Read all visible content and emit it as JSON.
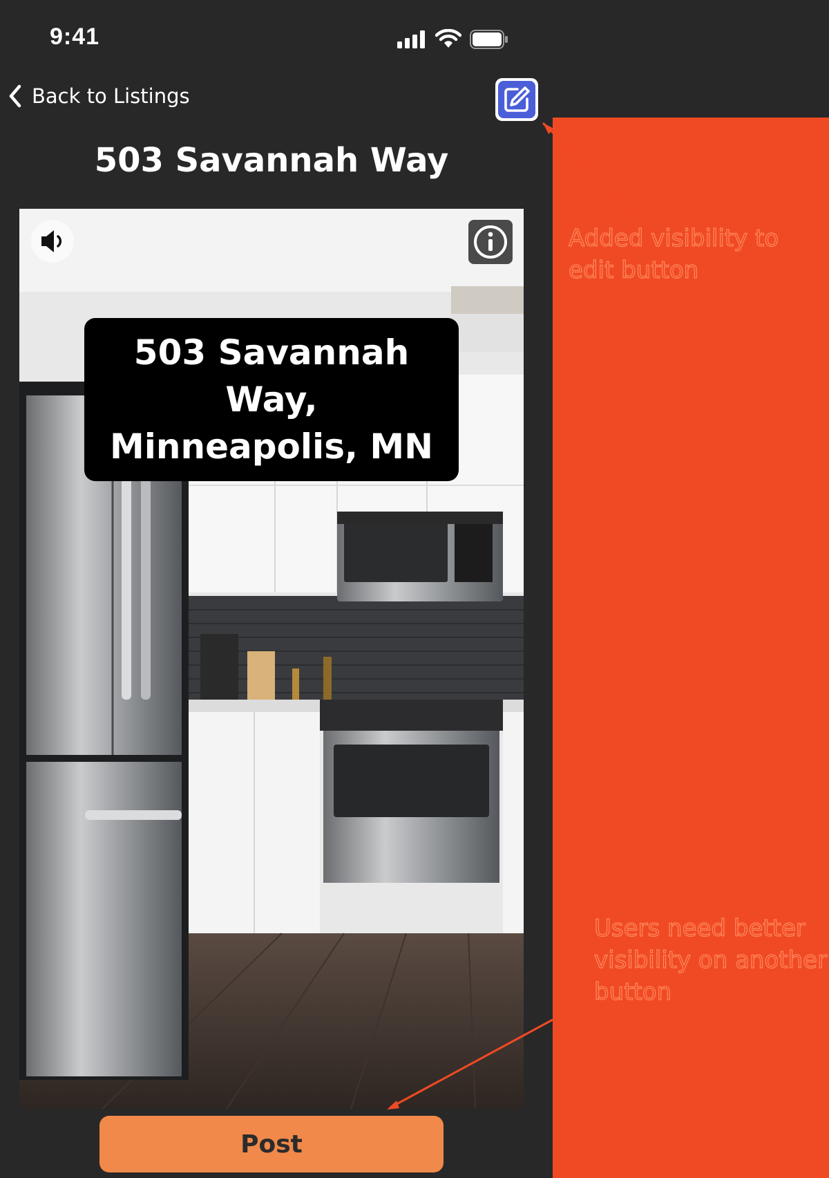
{
  "status_bar": {
    "time": "9:41",
    "icons": [
      "signal-icon",
      "wifi-icon",
      "battery-icon"
    ]
  },
  "nav": {
    "back_label": "Back to Listings",
    "back_icon": "chevron-left-icon",
    "edit_icon": "edit-icon"
  },
  "listing": {
    "title": "503 Savannah Way",
    "address_card": "503 Savannah Way, Minneapolis, MN",
    "photo_subject": "kitchen-photo",
    "sound_icon": "speaker-icon",
    "info_icon": "info-icon"
  },
  "actions": {
    "post_label": "Post"
  },
  "annotations": {
    "note_1": "Added visibility to edit button",
    "note_2": "Users need better visibility on another button"
  },
  "colors": {
    "background": "#282828",
    "accent_button": "#f0894a",
    "edit_button": "#4a5ed8",
    "annotation": "#f04a24"
  }
}
